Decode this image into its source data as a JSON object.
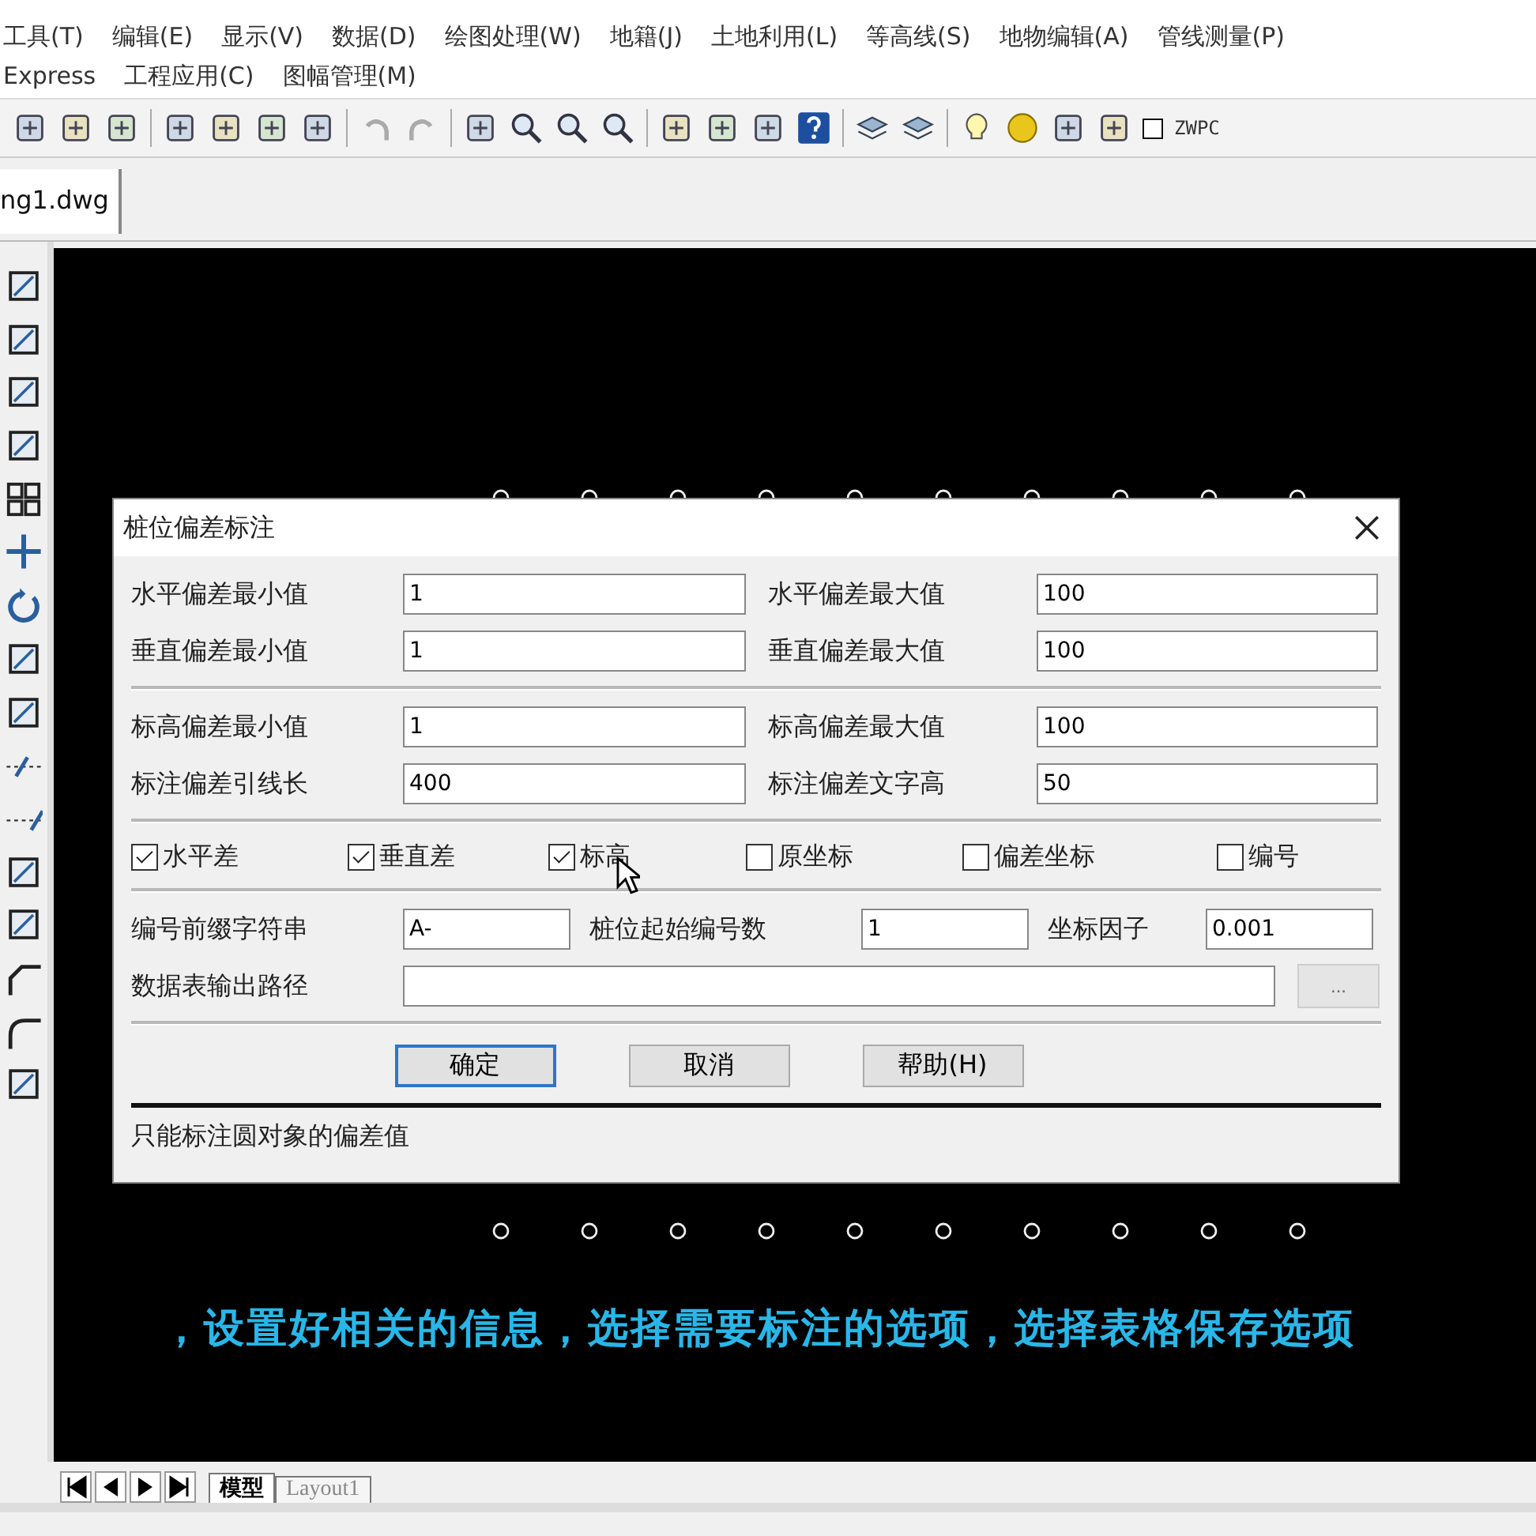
{
  "menu_rows": [
    [
      "工具(T)",
      "编辑(E)",
      "显示(V)",
      "数据(D)",
      "绘图处理(W)",
      "地籍(J)",
      "土地利用(L)",
      "等高线(S)",
      "地物编辑(A)",
      "管线测量(P)"
    ],
    [
      "Express",
      "工程应用(C)",
      "图幅管理(M)"
    ]
  ],
  "toolbar": {
    "layer_label": "ZWPC"
  },
  "document_tabs": [
    {
      "label": "ng1.dwg",
      "selected": true
    }
  ],
  "dialog": {
    "title": "桩位偏差标注",
    "field_rows": [
      [
        {
          "label": "水平偏差最小值",
          "value": "1"
        },
        {
          "label": "水平偏差最大值",
          "value": "100"
        }
      ],
      [
        {
          "label": "垂直偏差最小值",
          "value": "1"
        },
        {
          "label": "垂直偏差最大值",
          "value": "100"
        }
      ],
      [
        {
          "label": "标高偏差最小值",
          "value": "1"
        },
        {
          "label": "标高偏差最大值",
          "value": "100"
        }
      ],
      [
        {
          "label": "标注偏差引线长",
          "value": "400"
        },
        {
          "label": "标注偏差文字高",
          "value": "50"
        }
      ]
    ],
    "checkboxes": [
      {
        "label": "水平差",
        "checked": true
      },
      {
        "label": "垂直差",
        "checked": true
      },
      {
        "label": "标高",
        "checked": true
      },
      {
        "label": "原坐标",
        "checked": false
      },
      {
        "label": "偏差坐标",
        "checked": false
      },
      {
        "label": "编号",
        "checked": false
      }
    ],
    "numbering": [
      {
        "label": "编号前缀字符串",
        "value": "A-"
      },
      {
        "label": "桩位起始编号数",
        "value": "1"
      },
      {
        "label": "坐标因子",
        "value": "0.001"
      }
    ],
    "output_path": {
      "label": "数据表输出路径",
      "browse": "..."
    },
    "buttons": [
      {
        "label": "确定",
        "default": true
      },
      {
        "label": "取消",
        "default": false
      },
      {
        "label": "帮助(H)",
        "default": false
      }
    ],
    "status": "只能标注圆对象的偏差值"
  },
  "subtitle": "，设置好相关的信息，选择需要标注的选项，选择表格保存选项",
  "layout_tabs": [
    {
      "label": "模型",
      "selected": true
    },
    {
      "label": "Layout1",
      "selected": false
    }
  ]
}
